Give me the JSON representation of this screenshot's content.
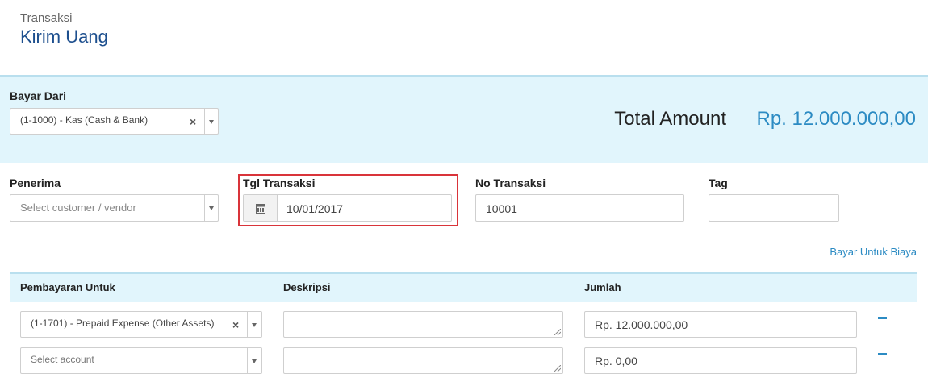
{
  "header": {
    "subtitle": "Transaksi",
    "title": "Kirim Uang"
  },
  "bayar_dari": {
    "label": "Bayar Dari",
    "value": "(1-1000) - Kas (Cash & Bank)",
    "clear_icon": "close-icon"
  },
  "total": {
    "label": "Total Amount",
    "value": "Rp. 12.000.000,00"
  },
  "penerima": {
    "label": "Penerima",
    "placeholder": "Select customer / vendor"
  },
  "tgl_transaksi": {
    "label": "Tgl Transaksi",
    "value": "10/01/2017",
    "icon": "calendar-icon",
    "highlight_color": "#d9343a"
  },
  "no_transaksi": {
    "label": "No Transaksi",
    "value": "10001"
  },
  "tag": {
    "label": "Tag",
    "value": ""
  },
  "bayar_untuk_biaya": {
    "label": "Bayar Untuk Biaya"
  },
  "table": {
    "columns": [
      "Pembayaran Untuk",
      "Deskripsi",
      "Jumlah"
    ],
    "rows": [
      {
        "account": "(1-1701) - Prepaid Expense (Other Assets)",
        "deskripsi": "",
        "jumlah": "Rp. 12.000.000,00",
        "has_clear": true
      },
      {
        "account": "Select account",
        "deskripsi": "",
        "jumlah": "Rp. 0,00",
        "has_clear": false
      }
    ]
  },
  "colors": {
    "brand_title": "#1d4f8e",
    "accent": "#2c8bc3",
    "panel_bg": "#e1f5fc"
  }
}
